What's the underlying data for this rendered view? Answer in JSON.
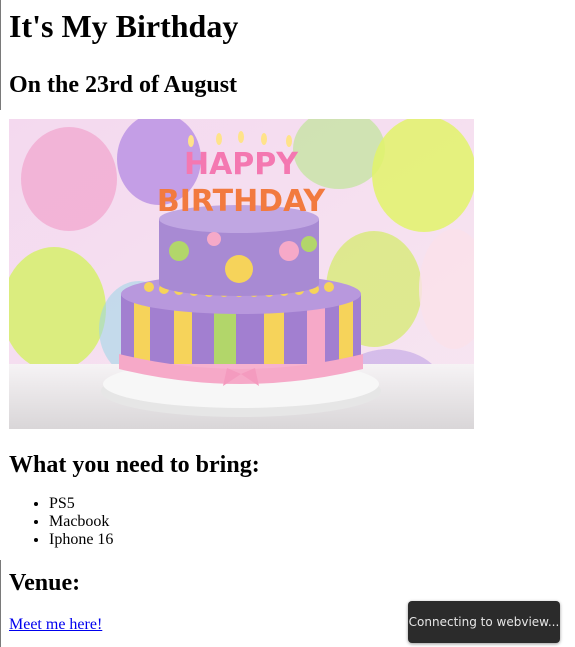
{
  "page": {
    "title": "It's My Birthday",
    "subtitle": "On the 23rd of August"
  },
  "image": {
    "alt": "Birthday cake with Happy Birthday candles and balloons",
    "candle_text": "HAPPY BIRTHDAY",
    "colors": {
      "background": "#f3d8ea",
      "cake_top": "#b596d4",
      "cake_bottom": "#9c7ccc",
      "stripe_pink": "#f6a9c8",
      "stripe_yellow": "#f6d35a",
      "stripe_green": "#b2d66a",
      "plate": "#f0f0f0"
    }
  },
  "bring": {
    "heading": "What you need to bring:",
    "items": [
      "PS5",
      "Macbook",
      "Iphone 16"
    ]
  },
  "venue": {
    "heading": "Venue:",
    "link_text": "Meet me here!"
  },
  "toast": {
    "text": "Connecting to webview..."
  }
}
